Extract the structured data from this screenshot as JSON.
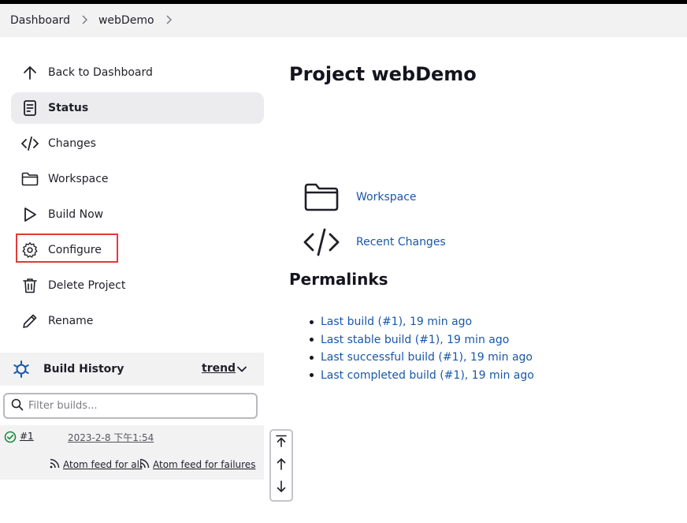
{
  "breadcrumb": {
    "items": [
      "Dashboard",
      "webDemo"
    ]
  },
  "sidebar": {
    "items": [
      {
        "label": "Back to Dashboard",
        "icon": "arrow-up-icon"
      },
      {
        "label": "Status",
        "icon": "document-icon",
        "active": true
      },
      {
        "label": "Changes",
        "icon": "code-icon"
      },
      {
        "label": "Workspace",
        "icon": "folder-icon"
      },
      {
        "label": "Build Now",
        "icon": "play-icon"
      },
      {
        "label": "Configure",
        "icon": "gear-icon",
        "highlighted": true
      },
      {
        "label": "Delete Project",
        "icon": "trash-icon"
      },
      {
        "label": "Rename",
        "icon": "pencil-icon"
      }
    ]
  },
  "build_history": {
    "title": "Build History",
    "trend_label": "trend",
    "filter_placeholder": "Filter builds...",
    "builds": [
      {
        "number": "#1",
        "timestamp": "2023-2-8 下午1:54",
        "status": "success"
      }
    ],
    "feeds": {
      "all": "Atom feed for all",
      "failures": "Atom feed for failures"
    }
  },
  "main": {
    "title": "Project webDemo",
    "links": [
      {
        "label": "Workspace",
        "icon": "folder-icon"
      },
      {
        "label": "Recent Changes",
        "icon": "code-icon"
      }
    ],
    "permalinks_title": "Permalinks",
    "permalinks": [
      "Last build (#1), 19 min ago",
      "Last stable build (#1), 19 min ago",
      "Last successful build (#1), 19 min ago",
      "Last completed build (#1), 19 min ago"
    ]
  },
  "colors": {
    "link": "#1957a8",
    "highlight": "#e03b3b",
    "success": "#1e8a3c"
  }
}
